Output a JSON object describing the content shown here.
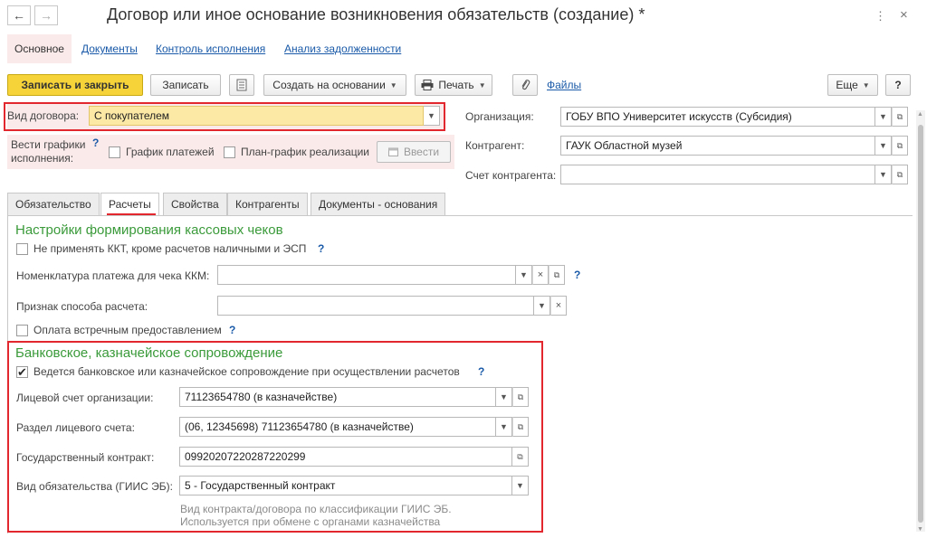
{
  "window": {
    "title": "Договор или иное основание возникновения обязательств (создание) *",
    "back": "←",
    "forward": "→",
    "more": "⋮",
    "close": "×"
  },
  "sections": [
    "Основное",
    "Документы",
    "Контроль исполнения",
    "Анализ задолженности"
  ],
  "toolbar": {
    "save_close": "Записать и закрыть",
    "save": "Записать",
    "create_based": "Создать на основании",
    "print": "Печать",
    "files": "Файлы",
    "more": "Еще",
    "help": "?"
  },
  "header": {
    "contract_type_label": "Вид договора:",
    "contract_type_value": "С покупателем",
    "schedules_label_1": "Вести графики",
    "schedules_label_2": "исполнения:",
    "schedules_q": "?",
    "payment_schedule": "График платежей",
    "realization_schedule": "План-график реализации",
    "enter_button": "Ввести",
    "org_label": "Организация:",
    "org_value": "ГОБУ ВПО Университет искусств (Субсидия)",
    "counterparty_label": "Контрагент:",
    "counterparty_value": "ГАУК Областной музей",
    "account_label": "Счет контрагента:",
    "account_value": ""
  },
  "tabs": [
    "Обязательство",
    "Расчеты",
    "Свойства",
    "Контрагенты",
    "Документы - основания"
  ],
  "receipts": {
    "title": "Настройки формирования кассовых чеков",
    "no_kkt": "Не применять ККТ, кроме расчетов наличными и ЭСП",
    "nomenclature_label": "Номенклатура платежа для чека ККМ:",
    "nomenclature_value": "",
    "payment_method_label": "Признак способа расчета:",
    "payment_method_value": "",
    "counter_provision": "Оплата встречным предоставлением",
    "q": "?"
  },
  "banking": {
    "title": "Банковское, казначейское сопровождение",
    "enabled_label": "Ведется банковское или казначейское сопровождение при осуществлении расчетов",
    "enabled": true,
    "org_account_label": "Лицевой счет организации:",
    "org_account_value": "71123654780 (в казначействе)",
    "account_section_label": "Раздел лицевого счета:",
    "account_section_value": "(06, 12345698) 71123654780 (в казначействе)",
    "state_contract_label": "Государственный контракт:",
    "state_contract_value": "09920207220287220299",
    "obligation_type_label": "Вид обязательства (ГИИС ЭБ):",
    "obligation_type_value": "5 - Государственный контракт",
    "hint_1": "Вид контракта/договора по классификации ГИИС ЭБ.",
    "hint_2": "Используется при обмене с органами казначейства",
    "q": "?"
  },
  "colors": {
    "accent_red": "#e2282e",
    "section_green": "#3a9a3a",
    "link_blue": "#1a5aa8",
    "primary_yellow": "#f6d338"
  }
}
